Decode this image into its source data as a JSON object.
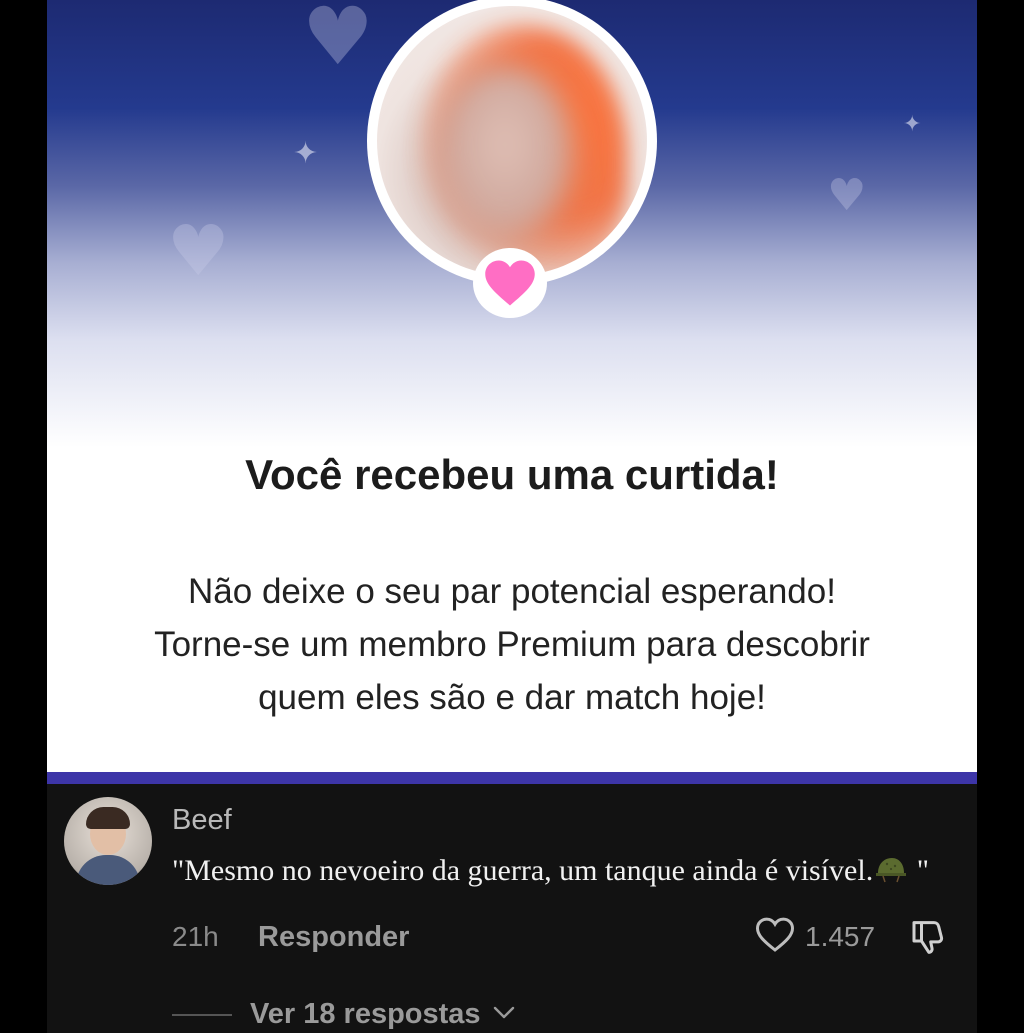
{
  "card": {
    "title": "Você recebeu uma curtida!",
    "body_lines": [
      "Não deixe o seu par potencial esperando!",
      "Torne-se um membro Premium para descobrir",
      "quem eles são e dar match hoje!"
    ],
    "accent_color": "#3d35a8",
    "heart_color": "#ff6ec4"
  },
  "comment": {
    "author": "Beef",
    "text_before": "\"Mesmo no nevoeiro da guerra, um tanque ainda é visível.",
    "text_after": " \"",
    "icon": "military-helmet-icon",
    "time": "21h",
    "reply_label": "Responder",
    "like_count": "1.457",
    "view_replies_label": "Ver 18 respostas"
  }
}
